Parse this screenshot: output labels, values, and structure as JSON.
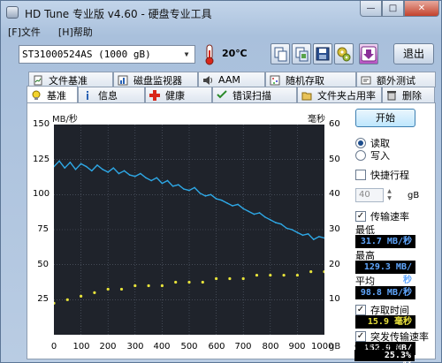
{
  "window": {
    "title": "HD Tune 专业版 v4.60 - 硬盘专业工具"
  },
  "menu": [
    {
      "label": "[F]文件"
    },
    {
      "label": "[H]帮助"
    }
  ],
  "toolbar": {
    "drive": "ST31000524AS (1000 gB)",
    "temperature": "20℃",
    "exit_label": "退出"
  },
  "tabs_top": [
    {
      "label": "文件基准"
    },
    {
      "label": "磁盘监视器"
    },
    {
      "label": "AAM"
    },
    {
      "label": "随机存取"
    },
    {
      "label": "额外测试"
    }
  ],
  "tabs_bottom": [
    {
      "label": "基准"
    },
    {
      "label": "信息"
    },
    {
      "label": "健康"
    },
    {
      "label": "错误扫描"
    },
    {
      "label": "文件夹占用率"
    },
    {
      "label": "删除"
    }
  ],
  "chart": {
    "left_unit": "MB/秒",
    "right_unit": "毫秒",
    "x_unit": "gB",
    "left_ticks": [
      "150",
      "125",
      "100",
      "75",
      "50",
      "25"
    ],
    "right_ticks": [
      "60",
      "50",
      "40",
      "30",
      "20",
      "10"
    ],
    "x_ticks": [
      "0",
      "100",
      "200",
      "300",
      "400",
      "500",
      "600",
      "700",
      "800",
      "900",
      "1000"
    ]
  },
  "chart_data": {
    "type": "line",
    "xlabel": "gB",
    "ylabel": "MB/秒",
    "y2label": "毫秒",
    "xlim": [
      0,
      1000
    ],
    "ylim": [
      0,
      150
    ],
    "y2lim": [
      0,
      60
    ],
    "grid": true,
    "colors": {
      "transfer": "#2ea8e6",
      "access": "#e6e23a",
      "background": "#1f232b",
      "grid": "#5a6170"
    },
    "series": [
      {
        "x": [
          0,
          20,
          40,
          60,
          80,
          100,
          120,
          140,
          160,
          180,
          200,
          220,
          240,
          260,
          280,
          300,
          320,
          340,
          360,
          380,
          400,
          420,
          440,
          460,
          480,
          500,
          520,
          540,
          560,
          580,
          600,
          620,
          640,
          660,
          680,
          700,
          720,
          740,
          760,
          780,
          800,
          820,
          840,
          860,
          880,
          900,
          920,
          940,
          960,
          980,
          1000
        ],
        "values": [
          120,
          124,
          119,
          123,
          118,
          122,
          120,
          117,
          121,
          118,
          116,
          119,
          115,
          117,
          114,
          113,
          115,
          112,
          110,
          112,
          108,
          110,
          106,
          107,
          104,
          103,
          105,
          101,
          99,
          100,
          97,
          96,
          94,
          92,
          93,
          90,
          88,
          86,
          87,
          84,
          82,
          80,
          79,
          76,
          75,
          73,
          71,
          72,
          68,
          70,
          69
        ]
      },
      {
        "x": [
          0,
          50,
          100,
          150,
          200,
          250,
          300,
          350,
          400,
          450,
          500,
          550,
          600,
          650,
          700,
          750,
          800,
          850,
          900,
          950,
          1000
        ],
        "values": [
          9,
          10,
          11,
          12,
          13,
          13,
          14,
          14,
          14,
          15,
          15,
          15,
          16,
          16,
          16,
          17,
          17,
          17,
          17,
          18,
          18
        ]
      }
    ]
  },
  "side": {
    "start_label": "开始",
    "read_label": "读取",
    "write_label": "写入",
    "short_stroke_label": "快捷行程",
    "short_stroke_value": "40",
    "short_stroke_unit": "gB",
    "transfer_rate_label": "传输速率",
    "min_label": "最低",
    "min_value": "31.7 MB/秒",
    "max_label": "最高",
    "max_value": "129.3 MB/秒",
    "avg_label": "平均",
    "avg_value": "98.8 MB/秒",
    "access_time_label": "存取时间",
    "access_time_value": "15.9 毫秒",
    "burst_rate_label": "突发传输速率",
    "burst_rate_value": "152.9 MB/秒",
    "cpu_label": "CPU 占用率",
    "cpu_value": "25.3%"
  }
}
